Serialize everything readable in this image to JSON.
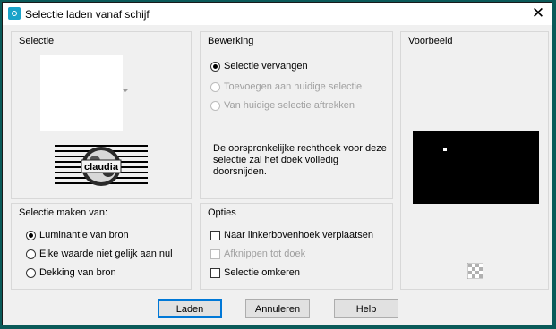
{
  "window": {
    "title": "Selectie laden vanaf schijf",
    "close_glyph": "✕"
  },
  "selectie_group": {
    "label": "Selectie",
    "thumbnail_text": "claudia"
  },
  "bewerking_group": {
    "label": "Bewerking",
    "options": [
      {
        "label": "Selectie vervangen",
        "checked": true,
        "disabled": false
      },
      {
        "label": "Toevoegen aan huidige selectie",
        "checked": false,
        "disabled": true
      },
      {
        "label": "Van huidige selectie aftrekken",
        "checked": false,
        "disabled": true
      }
    ],
    "description": "De oorspronkelijke rechthoek voor deze selectie zal het doek volledig doorsnijden."
  },
  "voorbeeld_group": {
    "label": "Voorbeeld",
    "checker_icon": "transparency-checker-icon"
  },
  "maken_group": {
    "label": "Selectie maken van:",
    "options": [
      {
        "label": "Luminantie van bron",
        "checked": true
      },
      {
        "label": "Elke waarde niet gelijk aan nul",
        "checked": false
      },
      {
        "label": "Dekking van bron",
        "checked": false
      }
    ]
  },
  "opties_group": {
    "label": "Opties",
    "options": [
      {
        "label": "Naar linkerbovenhoek verplaatsen",
        "checked": false,
        "disabled": false
      },
      {
        "label": "Afknippen tot doek",
        "checked": false,
        "disabled": true
      },
      {
        "label": "Selectie omkeren",
        "checked": false,
        "disabled": false
      }
    ]
  },
  "buttons": {
    "load": "Laden",
    "cancel": "Annuleren",
    "help": "Help"
  }
}
